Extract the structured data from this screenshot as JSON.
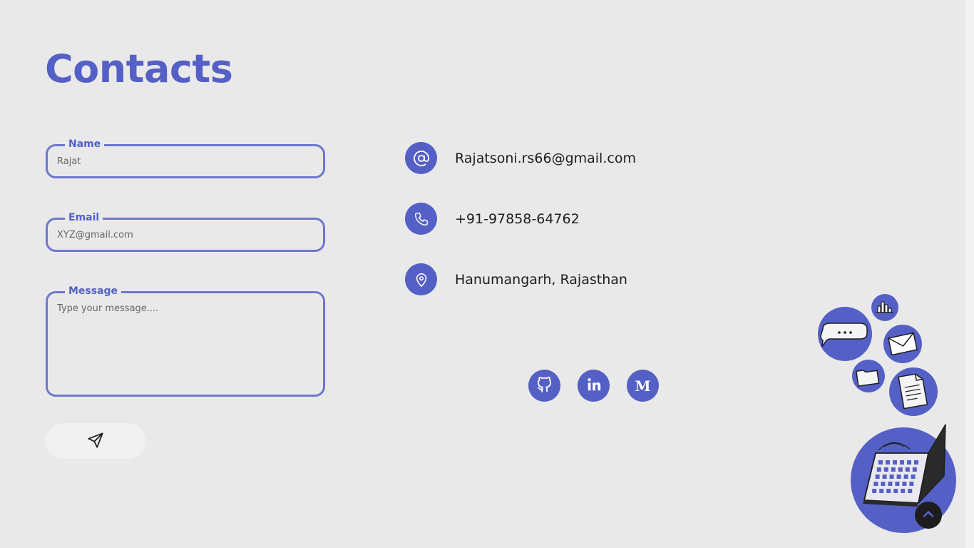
{
  "page": {
    "title": "Contacts"
  },
  "form": {
    "name": {
      "label": "Name",
      "placeholder": "Rajat"
    },
    "email": {
      "label": "Email",
      "placeholder": "XYZ@gmail.com"
    },
    "message": {
      "label": "Message",
      "placeholder": "Type your message...."
    },
    "send_icon": "paper-plane-icon"
  },
  "contact_info": {
    "email": {
      "text": "Rajatsoni.rs66@gmail.com",
      "icon": "at-icon"
    },
    "phone": {
      "text": "+91-97858-64762",
      "icon": "phone-icon"
    },
    "location": {
      "text": "Hanumangarh, Rajasthan",
      "icon": "location-pin-icon"
    }
  },
  "social": [
    {
      "name": "github",
      "icon": "github-icon"
    },
    {
      "name": "linkedin",
      "icon": "linkedin-icon",
      "glyph": "in"
    },
    {
      "name": "medium",
      "icon": "medium-icon",
      "glyph": "M"
    }
  ],
  "scroll_top": {
    "icon": "chevron-up-icon"
  },
  "colors": {
    "accent": "#5560c6",
    "field_border": "#7077cd",
    "background": "#e9e9ea",
    "text": "#1e1e1e",
    "dark": "#1d1d1d"
  }
}
